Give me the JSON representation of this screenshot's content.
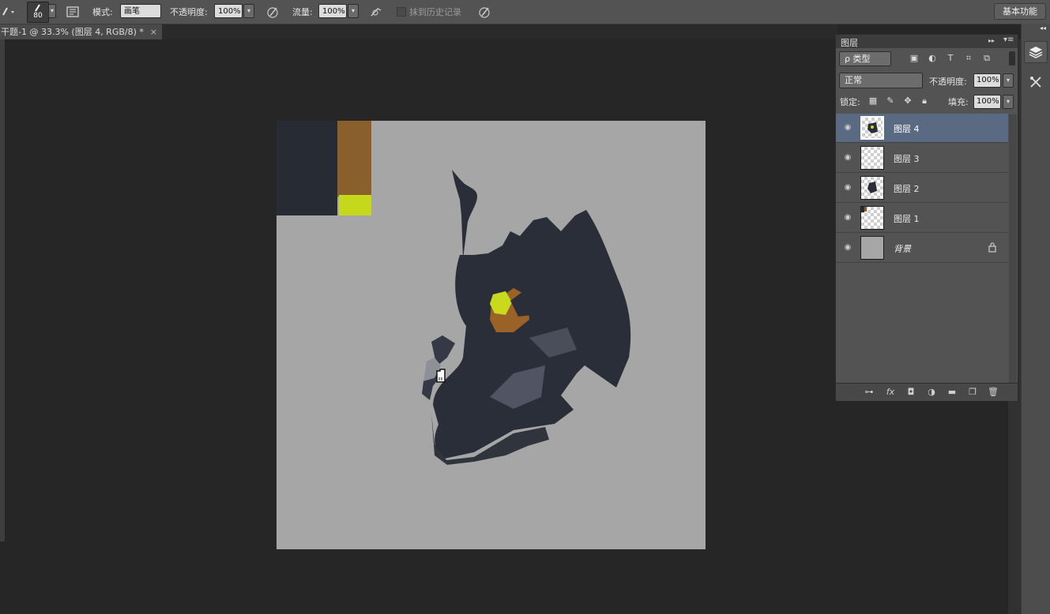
{
  "options_bar": {
    "brush_size": "80",
    "mode_label": "模式:",
    "mode_value": "画笔",
    "opacity_label": "不透明度:",
    "opacity_value": "100%",
    "flow_label": "流量:",
    "flow_value": "100%",
    "history_label": "抹到历史记录",
    "workspace_label": "基本功能"
  },
  "document_tab": {
    "title": "干题-1 @ 33.3% (图层 4, RGB/8) *",
    "close": "×"
  },
  "layers_panel": {
    "title": "图层",
    "filter_kind": "ρ 类型",
    "blend_mode": "正常",
    "opacity_label": "不透明度:",
    "opacity_value": "100%",
    "lock_label": "锁定:",
    "fill_label": "填充:",
    "fill_value": "100%",
    "layers": [
      {
        "name": "图层 4",
        "selected": true
      },
      {
        "name": "图层 3",
        "selected": false
      },
      {
        "name": "图层 2",
        "selected": false
      },
      {
        "name": "图层 1",
        "selected": false
      },
      {
        "name": "背景",
        "selected": false,
        "locked": true
      }
    ],
    "footer_icons": [
      "link-icon",
      "fx-icon",
      "mask-icon",
      "adjustment-icon",
      "folder-icon",
      "new-layer-icon",
      "trash-icon"
    ]
  },
  "canvas": {
    "background": "#a6a6a6",
    "swatches": [
      "#272b34",
      "#8b5f2c",
      "#c6d81c"
    ]
  },
  "colors": {
    "ui_dark": "#262626",
    "ui_mid": "#535353",
    "selection": "#596a82"
  }
}
